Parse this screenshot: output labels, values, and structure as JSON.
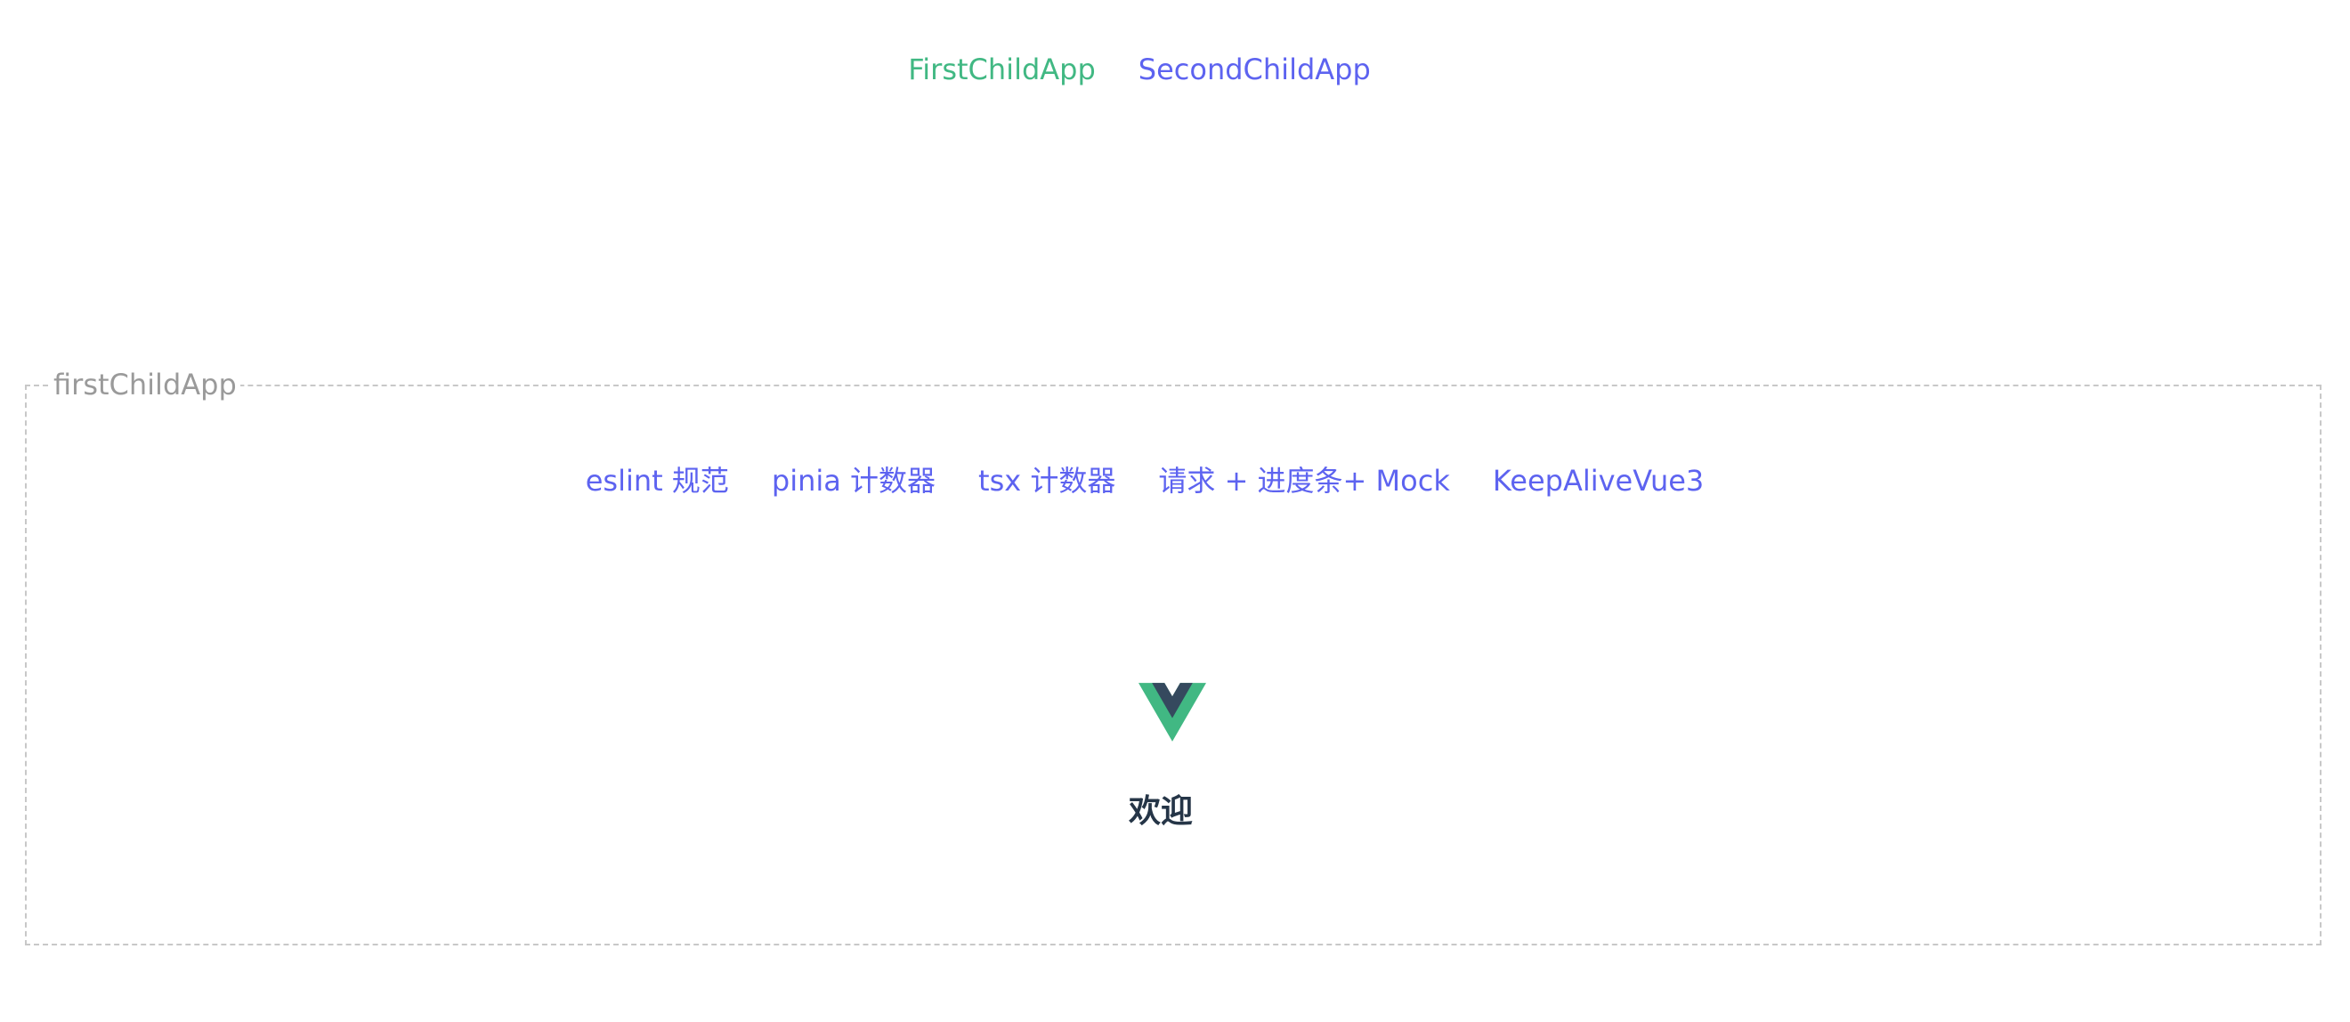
{
  "top_nav": {
    "links": [
      {
        "label": "FirstChildApp",
        "color": "#41b883"
      },
      {
        "label": "SecondChildApp",
        "color": "#5d63f0"
      }
    ]
  },
  "micro_app": {
    "legend": "firstChildApp",
    "nav": [
      "eslint 规范",
      "pinia 计数器",
      "tsx 计数器",
      "请求 + 进度条+ Mock",
      "KeepAliveVue3"
    ],
    "logo_icon": "vue-logo-icon",
    "welcome_text": "欢迎",
    "colors": {
      "link": "#5d63f0",
      "vue_green": "#41b883",
      "vue_dark": "#35495e",
      "welcome": "#253547",
      "border": "#c8c8c8"
    }
  }
}
